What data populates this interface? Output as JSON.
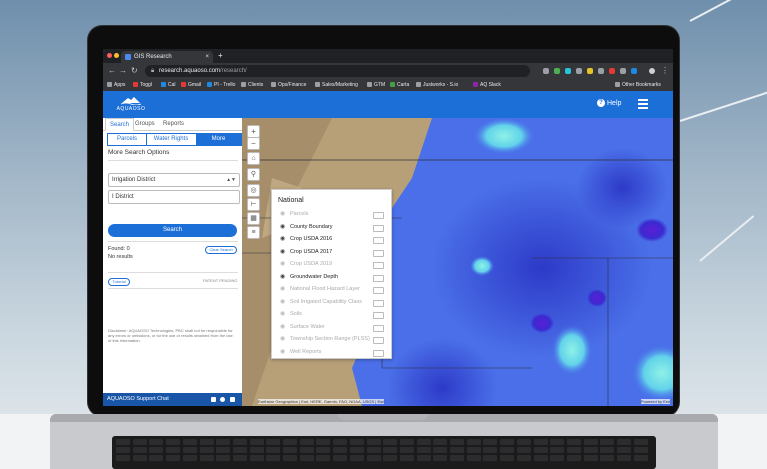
{
  "browser": {
    "tab_title": "GIS Research",
    "tab_close": "×",
    "new_tab": "+",
    "url_host": "research.aquaoso.com",
    "url_path": "/research/",
    "back": "←",
    "forward": "→",
    "reload": "↻",
    "bookmarks": [
      "Apps",
      "Toggl",
      "Cal",
      "Gmail",
      "PI - Trello",
      "Clients",
      "Ops/Finance",
      "Sales/Marketing",
      "GTM",
      "Carta",
      "Justworks - S.io",
      "AQ Slack"
    ],
    "other_bookmarks": "Other Bookmarks"
  },
  "app": {
    "brand": "AQUAOSO",
    "help_label": "Help",
    "help_icon": "?"
  },
  "panel": {
    "tabs": [
      "Search",
      "Groups",
      "Reports"
    ],
    "subtabs": [
      "Parcels",
      "Water Rights",
      "More"
    ],
    "more_options_label": "More Search Options",
    "select_value": "Irrigation District",
    "input_value": "I District",
    "search_button": "Search",
    "found_label": "Found: 0",
    "no_results": "No results",
    "clear_search": "Clear Search",
    "tutorial": "Tutorial",
    "patent_pending": "PATENT PENDING",
    "disclaimer": "Disclaimer: AQUAOSO Technologies, PBC shall not be responsible for any errors or omissions, or for the use or results obtained from the use of this information.",
    "chat_label": "AQUAOSO Support Chat"
  },
  "map": {
    "zoom_in": "+",
    "zoom_out": "−",
    "collapse": "«",
    "attribution": "Earthstar Geographics | Esri, HERE, Garmin, FAO, NOAA, USGS | Esri",
    "powered_by": "Powered by Esri"
  },
  "layers": {
    "title": "National",
    "items": [
      {
        "label": "Parcels",
        "visible": false
      },
      {
        "label": "County Boundary",
        "visible": true
      },
      {
        "label": "Crop USDA 2016",
        "visible": true
      },
      {
        "label": "Crop USDA 2017",
        "visible": true
      },
      {
        "label": "Crop USDA 2019",
        "visible": false
      },
      {
        "label": "Groundwater Depth",
        "visible": true
      },
      {
        "label": "National Flood Hazard Layer",
        "visible": false
      },
      {
        "label": "Soil Irrigated Capability Class",
        "visible": false
      },
      {
        "label": "Soils",
        "visible": false
      },
      {
        "label": "Surface Water",
        "visible": false
      },
      {
        "label": "Township Section Range (PLSS)",
        "visible": false
      },
      {
        "label": "Well Reports",
        "visible": false
      }
    ]
  },
  "colors": {
    "brand_blue": "#1d6fd8",
    "chat_blue": "#1a56a8",
    "heat_deep": "#2a1fb0",
    "heat_mid": "#4a6fe8",
    "heat_high": "#6fe0e0"
  }
}
